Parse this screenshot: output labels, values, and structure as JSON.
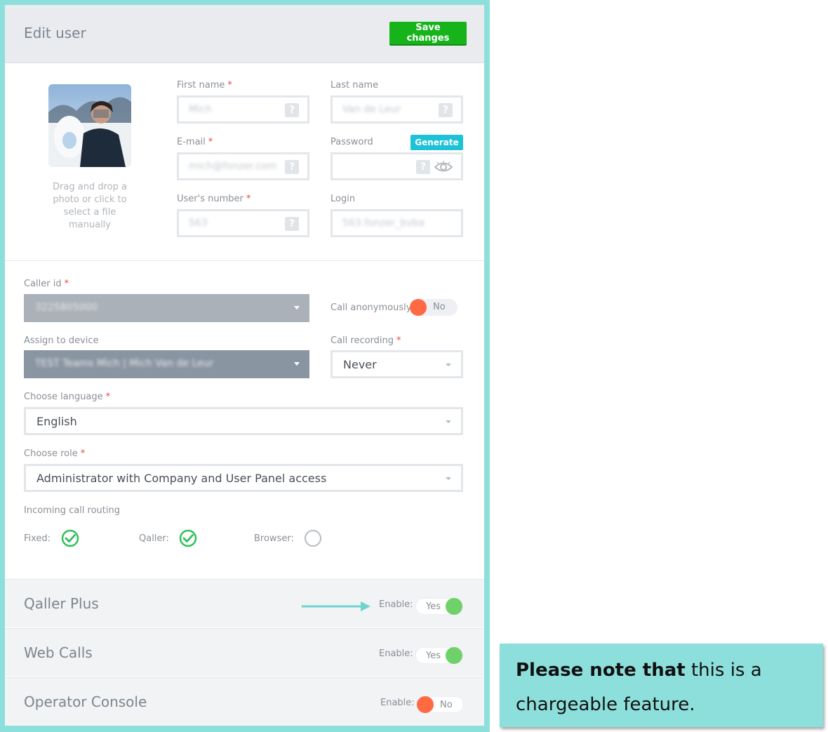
{
  "header": {
    "title": "Edit user",
    "save_label": "Save changes"
  },
  "photo": {
    "drop_text": "Drag and drop a photo or click to select a file manually"
  },
  "form": {
    "first_name": {
      "label": "First name",
      "required": "*",
      "value": "Mich",
      "help": "?"
    },
    "last_name": {
      "label": "Last name",
      "value": "Van de Leur",
      "help": "?"
    },
    "email": {
      "label": "E-mail",
      "required": "*",
      "value": "mich@fonzer.com",
      "help": "?"
    },
    "password": {
      "label": "Password",
      "generate_label": "Generate",
      "value": "",
      "help": "?"
    },
    "users_number": {
      "label": "User's number",
      "required": "*",
      "value": "563",
      "help": "?"
    },
    "login": {
      "label": "Login",
      "value": "563.fonzer_bvba"
    }
  },
  "caller_id": {
    "label": "Caller id",
    "required": "*",
    "value": "3225805000"
  },
  "call_anonymously": {
    "label": "Call anonymously:",
    "state": "No"
  },
  "assign_device": {
    "label": "Assign to device",
    "value": "TEST Teams Mich | Mich Van de Leur"
  },
  "call_recording": {
    "label": "Call recording",
    "required": "*",
    "value": "Never"
  },
  "language": {
    "label": "Choose language",
    "required": "*",
    "value": "English"
  },
  "role": {
    "label": "Choose role",
    "required": "*",
    "value": "Administrator with Company and User Panel access"
  },
  "routing": {
    "label": "Incoming call routing",
    "options": [
      {
        "label": "Fixed:",
        "checked": true
      },
      {
        "label": "Qaller:",
        "checked": true
      },
      {
        "label": "Browser:",
        "checked": false
      }
    ]
  },
  "features": [
    {
      "title": "Qaller Plus",
      "enable_label": "Enable:",
      "state": "Yes"
    },
    {
      "title": "Web Calls",
      "enable_label": "Enable:",
      "state": "Yes"
    },
    {
      "title": "Operator Console",
      "enable_label": "Enable:",
      "state": "No"
    }
  ],
  "note": {
    "bold": "Please note that",
    "rest": " this is a chargeable feature."
  },
  "colors": {
    "accent_teal": "#8ddfdb",
    "save_green": "#16b31b",
    "generate_cyan": "#1ec2d8",
    "toggle_on": "#6fd16a",
    "toggle_off": "#ff6a42",
    "check_green": "#2fc05a"
  }
}
